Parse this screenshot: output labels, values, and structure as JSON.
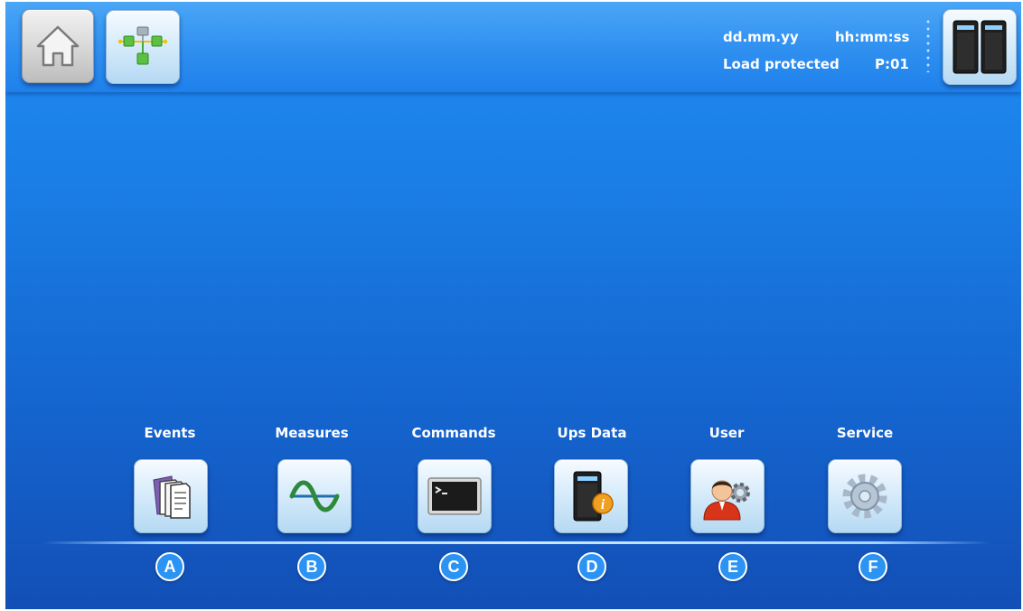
{
  "header": {
    "date": "dd.mm.yy",
    "time": "hh:mm:ss",
    "status": "Load protected",
    "page": "P:01",
    "icons": {
      "home": "home-icon",
      "network": "network-diagram-icon",
      "ups": "ups-cabinet-icon"
    }
  },
  "menu": [
    {
      "label": "Events",
      "badge": "A",
      "icon": "documents-icon"
    },
    {
      "label": "Measures",
      "badge": "B",
      "icon": "sine-wave-icon"
    },
    {
      "label": "Commands",
      "badge": "C",
      "icon": "terminal-icon"
    },
    {
      "label": "Ups Data",
      "badge": "D",
      "icon": "ups-info-icon"
    },
    {
      "label": "User",
      "badge": "E",
      "icon": "user-settings-icon"
    },
    {
      "label": "Service",
      "badge": "F",
      "icon": "gear-icon"
    }
  ],
  "colors": {
    "background": "#1a7ee6",
    "badge": "#2b93f3",
    "text": "#ffffff"
  }
}
